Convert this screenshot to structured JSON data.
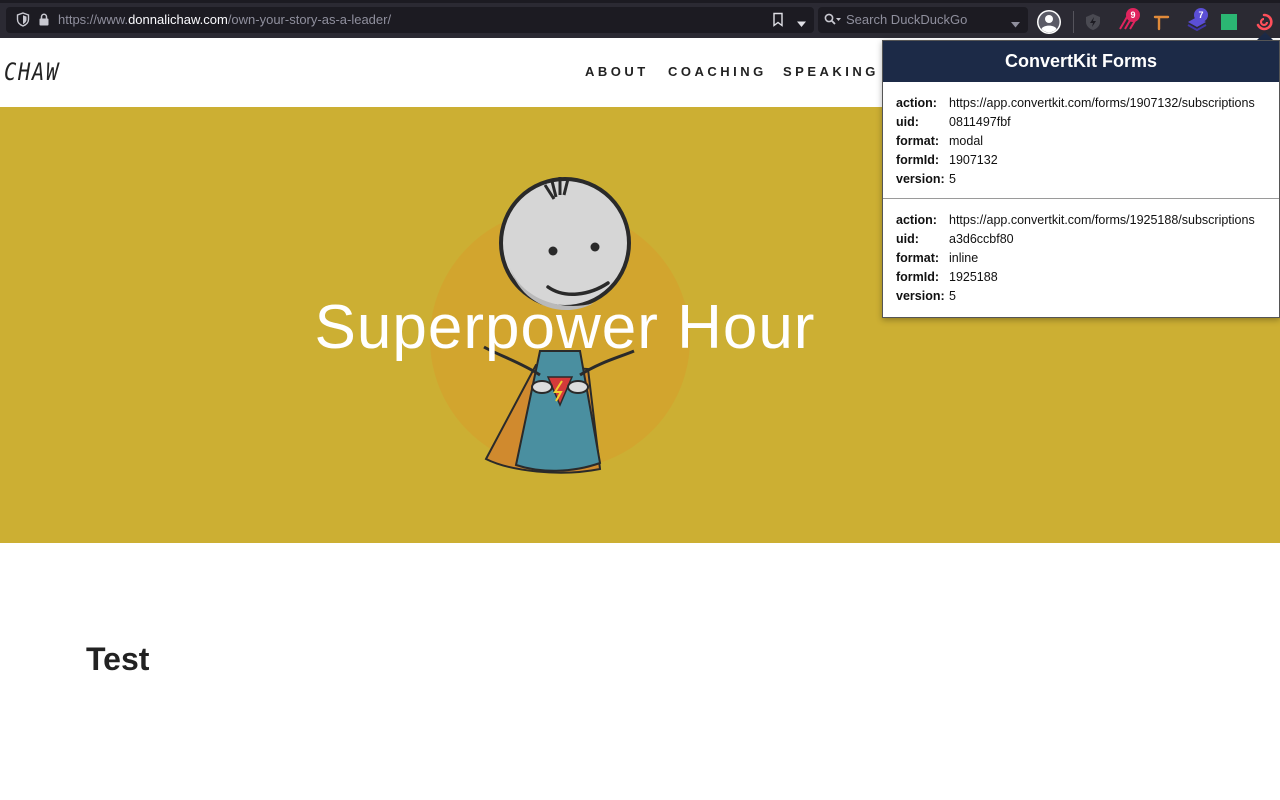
{
  "browser": {
    "url_prefix": "https://www.",
    "url_host": "donnalichaw.com",
    "url_path": "/own-your-story-as-a-leader/",
    "search_placeholder": "Search DuckDuckGo",
    "extensions": [
      {
        "name": "shield-extension-icon"
      },
      {
        "name": "ink-extension-icon",
        "badge": "9",
        "badge_color": "#e0245e"
      },
      {
        "name": "pickaxe-extension-icon"
      },
      {
        "name": "stack-extension-icon",
        "badge": "7",
        "badge_color": "#5b4fd6"
      },
      {
        "name": "green-square-extension-icon"
      },
      {
        "name": "convertkit-extension-icon"
      }
    ]
  },
  "site": {
    "logo": "CHAW",
    "nav": [
      "ABOUT",
      "COACHING",
      "SPEAKING"
    ],
    "hero_title": "Superpower Hour",
    "hero_color": "#ccaf33",
    "section_title": "Test"
  },
  "popup": {
    "title": "ConvertKit Forms",
    "header_color": "#1c2a47",
    "forms": [
      {
        "action_label": "action:",
        "action": "https://app.convertkit.com/forms/1907132/subscriptions",
        "uid_label": "uid:",
        "uid": "0811497fbf",
        "format_label": "format:",
        "format": "modal",
        "formId_label": "formId:",
        "formId": "1907132",
        "version_label": "version:",
        "version": "5"
      },
      {
        "action_label": "action:",
        "action": "https://app.convertkit.com/forms/1925188/subscriptions",
        "uid_label": "uid:",
        "uid": "a3d6ccbf80",
        "format_label": "format:",
        "format": "inline",
        "formId_label": "formId:",
        "formId": "1925188",
        "version_label": "version:",
        "version": "5"
      }
    ]
  }
}
